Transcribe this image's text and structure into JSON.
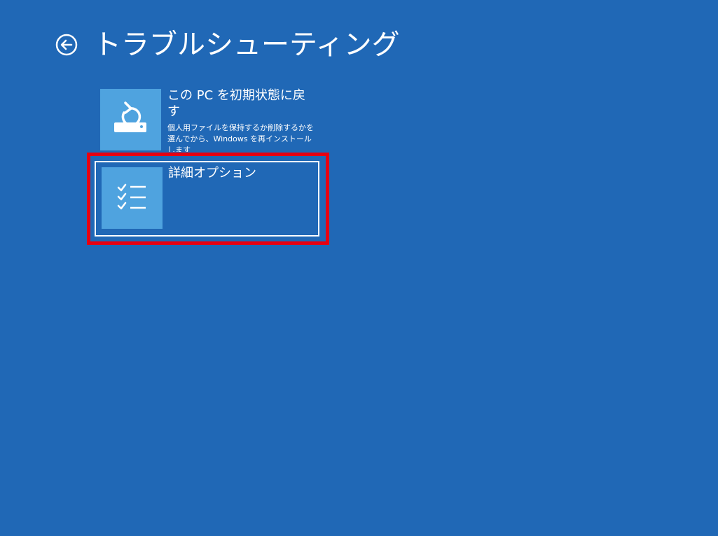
{
  "header": {
    "title": "トラブルシューティング",
    "back_icon": "back-arrow-circle-icon"
  },
  "options": [
    {
      "icon": "reset-pc-icon",
      "title": "この PC を初期状態に戻す",
      "description": "個人用ファイルを保持するか削除するかを選んでから、Windows を再インストールします"
    },
    {
      "icon": "checklist-icon",
      "title": "詳細オプション"
    }
  ],
  "colors": {
    "background": "#2068b6",
    "tile": "#4fa3df",
    "highlight": "#e60012",
    "text": "#ffffff"
  }
}
